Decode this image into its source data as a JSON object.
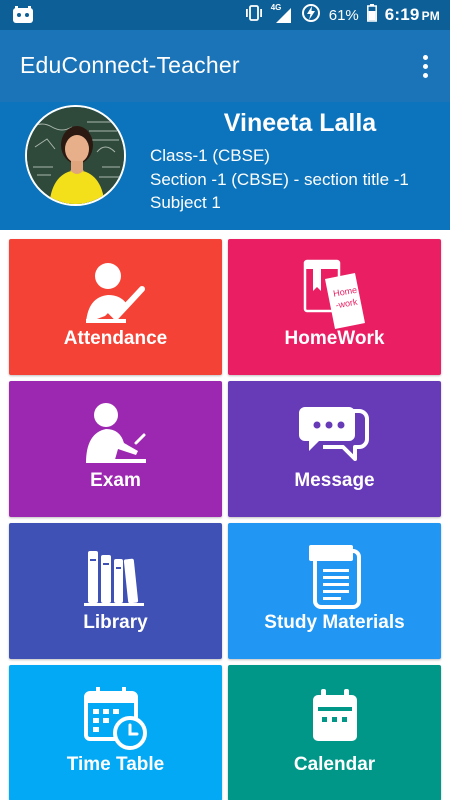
{
  "status_bar": {
    "network_label": "4G",
    "battery": "61%",
    "time": "6:19",
    "ampm": "PM",
    "icons": [
      "app-notification-icon",
      "vibrate-icon",
      "signal-icon",
      "data-saver-icon",
      "battery-icon"
    ]
  },
  "app_bar": {
    "title": "EduConnect-Teacher",
    "menu_icon": "more-vert-icon"
  },
  "profile": {
    "name": "Vineeta Lalla",
    "class": "Class-1 (CBSE)",
    "section": "Section -1 (CBSE) - section title -1",
    "subject": "Subject 1"
  },
  "tiles": [
    {
      "label": "Attendance",
      "icon": "attendance-icon",
      "color": "#f44336"
    },
    {
      "label": "HomeWork",
      "icon": "homework-icon",
      "color": "#e91e63"
    },
    {
      "label": "Exam",
      "icon": "exam-icon",
      "color": "#9c27b0"
    },
    {
      "label": "Message",
      "icon": "message-icon",
      "color": "#673ab7"
    },
    {
      "label": "Library",
      "icon": "library-icon",
      "color": "#3f51b5"
    },
    {
      "label": "Study Materials",
      "icon": "study-materials-icon",
      "color": "#2196f3"
    },
    {
      "label": "Time Table",
      "icon": "timetable-icon",
      "color": "#03a9f4"
    },
    {
      "label": "Calendar",
      "icon": "calendar-icon",
      "color": "#009688"
    }
  ],
  "homework_icon_text": "Home -work",
  "colors": {
    "status_bar": "#0d5f97",
    "app_bar": "#1a74b7",
    "profile_bg": "#0c74bc"
  }
}
